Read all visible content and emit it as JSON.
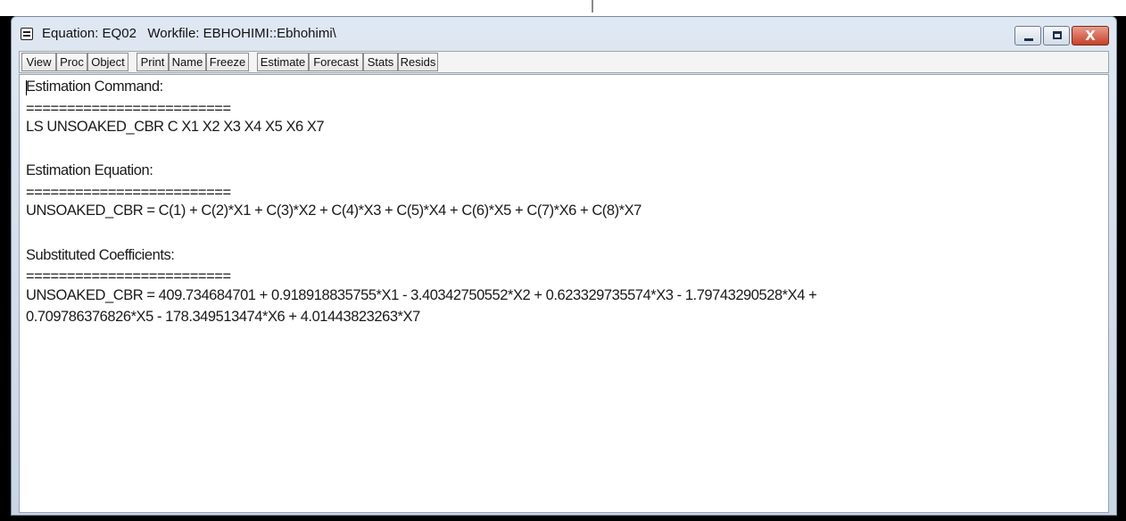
{
  "window": {
    "title": "Equation: EQ02   Workfile: EBHOHIMI::Ebhohimi\\",
    "close_glyph": "X"
  },
  "toolbar": {
    "buttons": [
      "View",
      "Proc",
      "Object",
      "Print",
      "Name",
      "Freeze",
      "Estimate",
      "Forecast",
      "Stats",
      "Resids"
    ]
  },
  "content": {
    "estimation_command_heading": "Estimation Command:",
    "separator": "=========================",
    "estimation_command": "LS UNSOAKED_CBR C X1 X2 X3 X4 X5 X6 X7",
    "estimation_equation_heading": "Estimation Equation:",
    "estimation_equation": "UNSOAKED_CBR = C(1) + C(2)*X1 + C(3)*X2 + C(4)*X3 + C(5)*X4 + C(6)*X5 + C(7)*X6 + C(8)*X7",
    "substituted_heading": "Substituted Coefficients:",
    "substituted_line1": "UNSOAKED_CBR = 409.734684701 + 0.918918835755*X1 - 3.40342750552*X2 + 0.623329735574*X3 - 1.79743290528*X4 +",
    "substituted_line2": "0.709786376826*X5 - 178.349513474*X6 + 4.01443823263*X7"
  }
}
